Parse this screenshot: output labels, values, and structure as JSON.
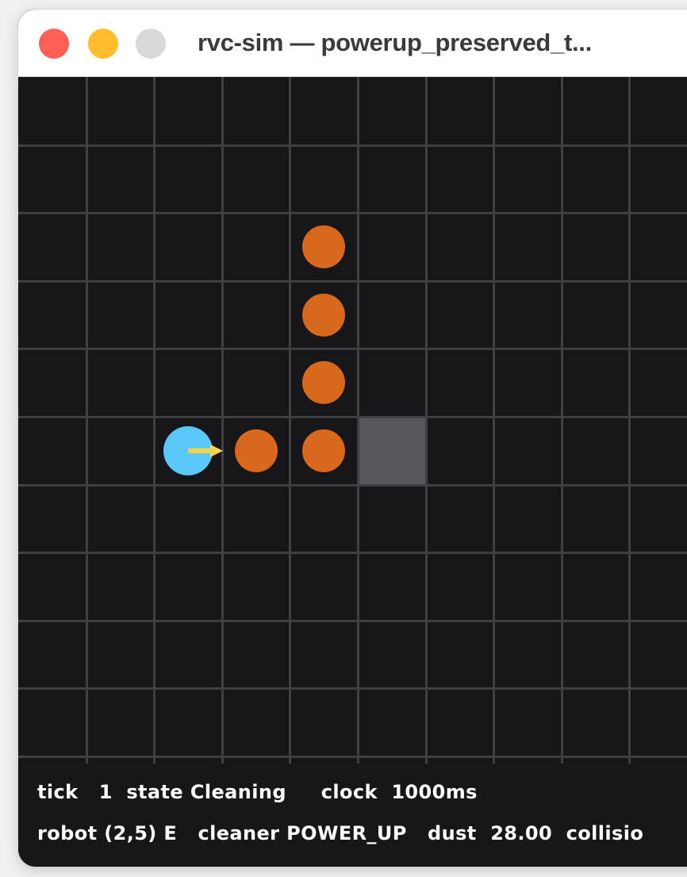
{
  "window": {
    "title": "rvc-sim — powerup_preserved_t..."
  },
  "grid": {
    "columns": 10,
    "rows": 10,
    "colors": {
      "background": "#17161a",
      "gridline": "#404044",
      "dust": "#d8691c",
      "robot": "#5ac8fa",
      "robot_arrow": "#ffd54a",
      "blocked_cell": "#56565c"
    },
    "robot": {
      "col": 2,
      "row": 5,
      "heading": "E"
    },
    "dust_cells": [
      {
        "col": 4,
        "row": 2
      },
      {
        "col": 4,
        "row": 3
      },
      {
        "col": 4,
        "row": 4
      },
      {
        "col": 3,
        "row": 5
      },
      {
        "col": 4,
        "row": 5
      }
    ],
    "blocked_cells": [
      {
        "col": 5,
        "row": 5
      }
    ]
  },
  "status": {
    "line1": "tick   1  state Cleaning     clock  1000ms",
    "line2": "robot (2,5) E   cleaner POWER_UP   dust  28.00  collisio"
  }
}
